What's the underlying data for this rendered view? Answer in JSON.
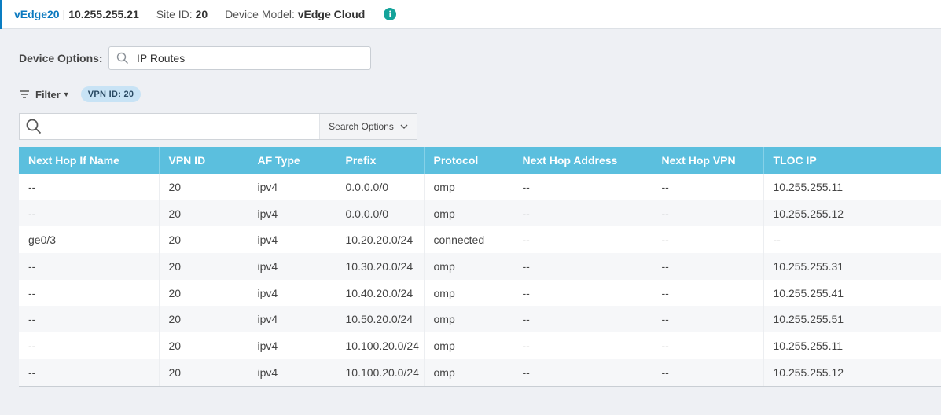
{
  "header": {
    "device_name": "vEdge20",
    "separator": "|",
    "device_ip": "10.255.255.21",
    "site_label": "Site ID:",
    "site_value": "20",
    "model_label": "Device Model:",
    "model_value": "vEdge Cloud",
    "info_icon": "i"
  },
  "device_options": {
    "label": "Device Options:",
    "value": "IP Routes"
  },
  "filter": {
    "label": "Filter",
    "chip": "VPN ID:  20"
  },
  "search": {
    "placeholder": "",
    "options_label": "Search Options"
  },
  "table": {
    "columns": [
      "Next Hop If Name",
      "VPN ID",
      "AF Type",
      "Prefix",
      "Protocol",
      "Next Hop Address",
      "Next Hop VPN",
      "TLOC IP"
    ],
    "rows": [
      [
        "--",
        "20",
        "ipv4",
        "0.0.0.0/0",
        "omp",
        "--",
        "--",
        "10.255.255.11"
      ],
      [
        "--",
        "20",
        "ipv4",
        "0.0.0.0/0",
        "omp",
        "--",
        "--",
        "10.255.255.12"
      ],
      [
        "ge0/3",
        "20",
        "ipv4",
        "10.20.20.0/24",
        "connected",
        "--",
        "--",
        "--"
      ],
      [
        "--",
        "20",
        "ipv4",
        "10.30.20.0/24",
        "omp",
        "--",
        "--",
        "10.255.255.31"
      ],
      [
        "--",
        "20",
        "ipv4",
        "10.40.20.0/24",
        "omp",
        "--",
        "--",
        "10.255.255.41"
      ],
      [
        "--",
        "20",
        "ipv4",
        "10.50.20.0/24",
        "omp",
        "--",
        "--",
        "10.255.255.51"
      ],
      [
        "--",
        "20",
        "ipv4",
        "10.100.20.0/24",
        "omp",
        "--",
        "--",
        "10.255.255.11"
      ],
      [
        "--",
        "20",
        "ipv4",
        "10.100.20.0/24",
        "omp",
        "--",
        "--",
        "10.255.255.12"
      ]
    ]
  },
  "colors": {
    "accent": "#0b79bf",
    "table_header": "#5bbfde",
    "info_icon": "#14a39a",
    "chip": "#c8e3f5"
  },
  "icons": {
    "search": "search-icon",
    "filter": "filter-icon",
    "info": "info-icon",
    "chevron": "chevron-down-icon"
  }
}
